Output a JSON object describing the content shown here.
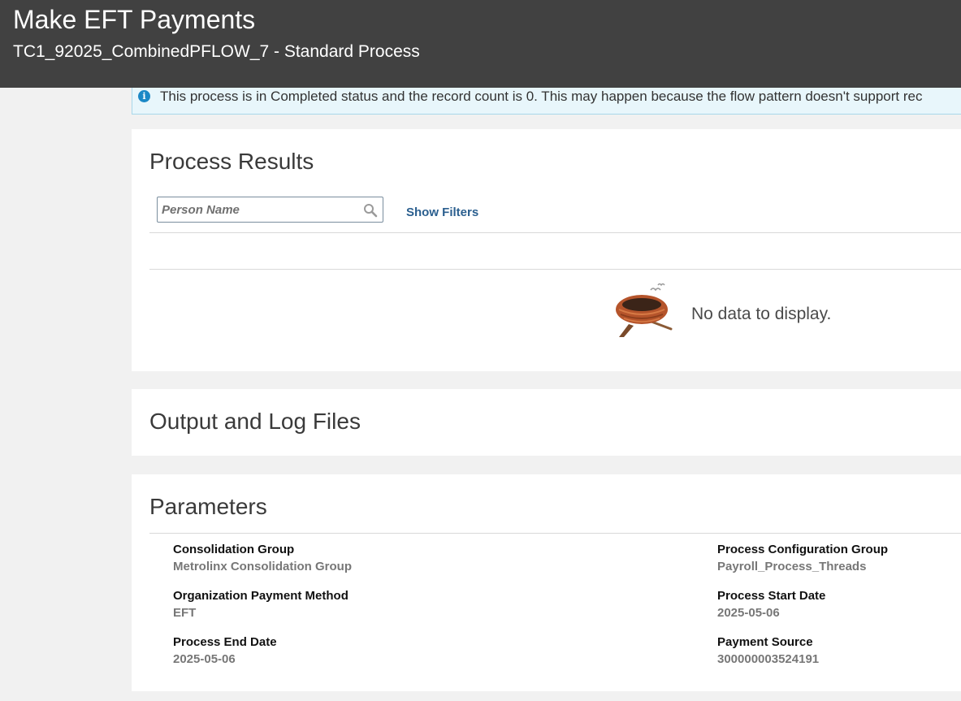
{
  "header": {
    "title": "Make EFT Payments",
    "subtitle": "TC1_92025_CombinedPFLOW_7 - Standard Process"
  },
  "info_banner": {
    "icon": "info-icon",
    "text": "This process is in Completed status and the record count is 0. This may happen because the flow pattern doesn't support rec"
  },
  "process_results": {
    "heading": "Process Results",
    "search_placeholder": "Person Name",
    "search_value": "",
    "show_filters_label": "Show Filters",
    "empty_message": "No data to display."
  },
  "output_logs": {
    "heading": "Output and Log Files"
  },
  "parameters": {
    "heading": "Parameters",
    "items": [
      {
        "label": "Consolidation Group",
        "value": "Metrolinx Consolidation Group"
      },
      {
        "label": "Process Configuration Group",
        "value": "Payroll_Process_Threads"
      },
      {
        "label": "Organization Payment Method",
        "value": "EFT"
      },
      {
        "label": "Process Start Date",
        "value": "2025-05-06"
      },
      {
        "label": "Process End Date",
        "value": "2025-05-06"
      },
      {
        "label": "Payment Source",
        "value": "300000003524191"
      }
    ]
  },
  "colors": {
    "header_bg": "#414141",
    "banner_bg": "#e8f6fb",
    "info_icon": "#1b88c6",
    "link": "#2b5f8f"
  }
}
